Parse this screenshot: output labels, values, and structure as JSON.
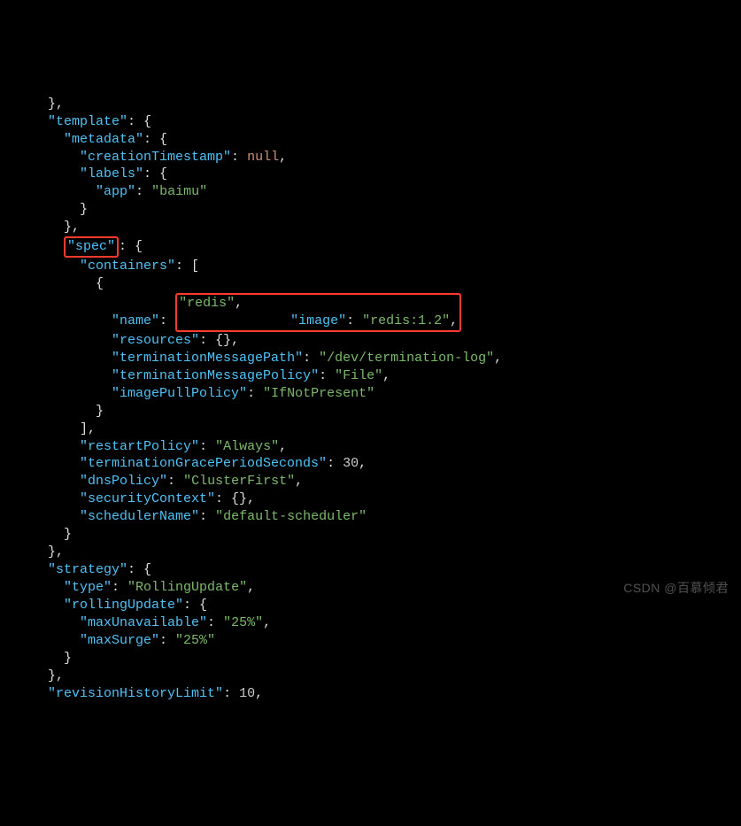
{
  "watermark": "CSDN @百慕倾君",
  "code": {
    "keys": {
      "template": "\"template\"",
      "metadata": "\"metadata\"",
      "creationTimestamp": "\"creationTimestamp\"",
      "labels": "\"labels\"",
      "app": "\"app\"",
      "spec": "\"spec\"",
      "containers": "\"containers\"",
      "name": "\"name\"",
      "image": "\"image\"",
      "resources": "\"resources\"",
      "terminationMessagePath": "\"terminationMessagePath\"",
      "terminationMessagePolicy": "\"terminationMessagePolicy\"",
      "imagePullPolicy": "\"imagePullPolicy\"",
      "restartPolicy": "\"restartPolicy\"",
      "terminationGracePeriodSeconds": "\"terminationGracePeriodSeconds\"",
      "dnsPolicy": "\"dnsPolicy\"",
      "securityContext": "\"securityContext\"",
      "schedulerName": "\"schedulerName\"",
      "strategy": "\"strategy\"",
      "type": "\"type\"",
      "rollingUpdate": "\"rollingUpdate\"",
      "maxUnavailable": "\"maxUnavailable\"",
      "maxSurge": "\"maxSurge\"",
      "revisionHistoryLimit": "\"revisionHistoryLimit\""
    },
    "vals": {
      "null": "null",
      "baimu": "\"baimu\"",
      "redis": "\"redis\"",
      "redis12": "\"redis:1.2\"",
      "termPath": "\"/dev/termination-log\"",
      "file": "\"File\"",
      "ifNot": "\"IfNotPresent\"",
      "always": "\"Always\"",
      "thirty": "30",
      "clusterFirst": "\"ClusterFirst\"",
      "defaultScheduler": "\"default-scheduler\"",
      "rollingUpdate": "\"RollingUpdate\"",
      "p25": "\"25%\"",
      "ten": "10"
    },
    "highlight": {
      "spec_boxed": true,
      "redis_boxed": true
    }
  }
}
